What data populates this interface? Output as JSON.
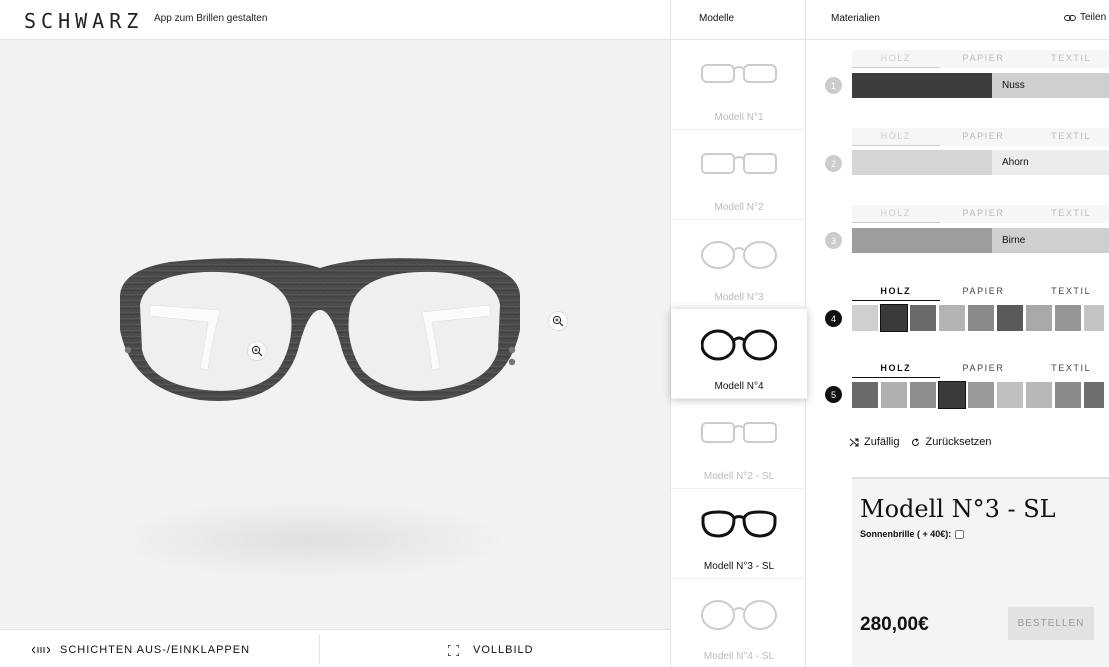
{
  "header": {
    "brand": "SCHWARZ",
    "tagline": "App zum Brillen gestalten",
    "models_col": "Modelle",
    "materials_col": "Materialien",
    "share_label": "Teilen"
  },
  "viewer": {
    "zoom_icon": "zoom-in-icon"
  },
  "bottombar": {
    "collapse_label": "SCHICHTEN AUS-/EINKLAPPEN",
    "fullscreen_label": "VOLLBILD"
  },
  "models": [
    {
      "label": "Modell N°1",
      "state": "dim"
    },
    {
      "label": "Modell N°2",
      "state": "dim"
    },
    {
      "label": "Modell N°3",
      "state": "dim"
    },
    {
      "label": "Modell N°4",
      "state": "active"
    },
    {
      "label": "Modell N°2 - SL",
      "state": "dim"
    },
    {
      "label": "Modell N°3 - SL",
      "state": "bold"
    },
    {
      "label": "Modell N°4 - SL",
      "state": "dim"
    }
  ],
  "materials": {
    "tabs": [
      "HOLZ",
      "PAPIER",
      "TEXTIL"
    ],
    "layers": [
      {
        "num": "1",
        "state": "collapsed",
        "material": "Nuss",
        "color": "#3d3d3d"
      },
      {
        "num": "2",
        "state": "collapsed",
        "material": "Ahorn",
        "color": "#d5d5d5"
      },
      {
        "num": "3",
        "state": "collapsed",
        "material": "Birne",
        "color": "#9d9d9d"
      },
      {
        "num": "4",
        "state": "open",
        "swatches": [
          "#cfcfcf",
          "#3a3a3a",
          "#6a6a6a",
          "#b4b4b4",
          "#8a8a8a",
          "#5a5a5a",
          "#a8a8a8",
          "#959595",
          "#c4c4c4"
        ]
      },
      {
        "num": "5",
        "state": "open",
        "swatches": [
          "#6a6a6a",
          "#b0b0b0",
          "#8e8e8e",
          "#3a3a3a",
          "#9a9a9a",
          "#c0c0c0",
          "#b8b8b8",
          "#8a8a8a",
          "#6e6e6e"
        ]
      }
    ],
    "random_label": "Zufällig",
    "reset_label": "Zurücksetzen"
  },
  "summary": {
    "title": "Modell N°3 - SL",
    "sunglasses_label": "Sonnenbrille ( + 40€):",
    "price": "280,00€",
    "order_label": "BESTELLEN"
  }
}
